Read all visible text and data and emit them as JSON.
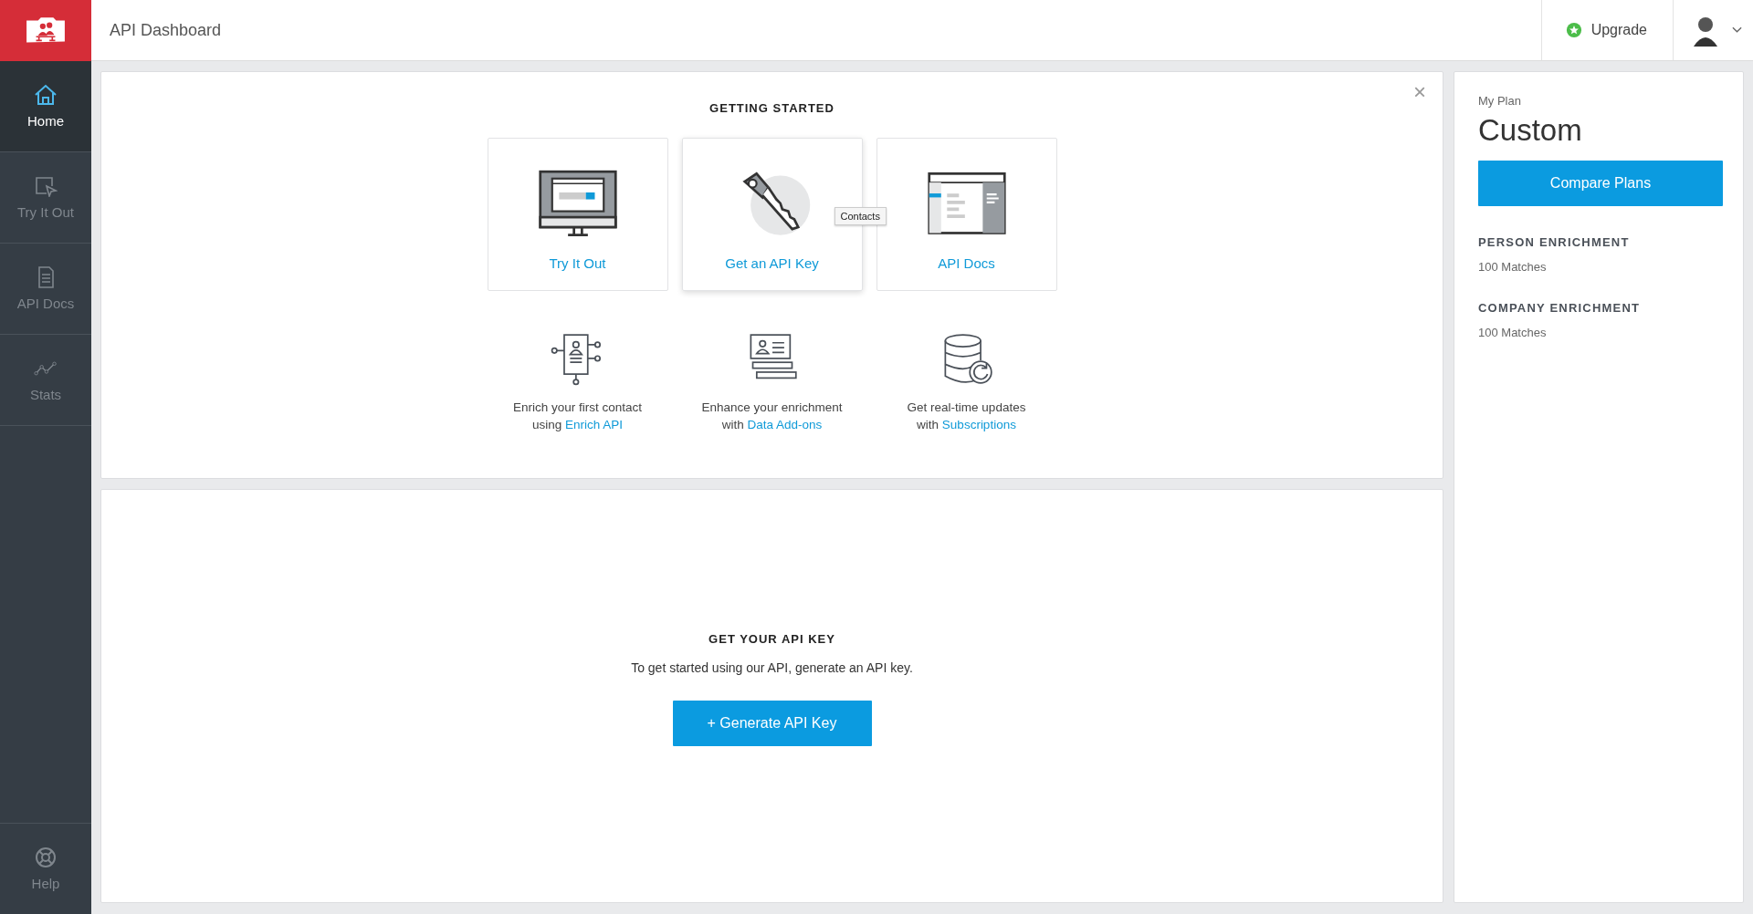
{
  "header": {
    "title": "API Dashboard",
    "upgrade": "Upgrade"
  },
  "sidebar": {
    "items": [
      {
        "label": "Home",
        "selected": true
      },
      {
        "label": "Try It Out",
        "selected": false
      },
      {
        "label": "API Docs",
        "selected": false
      },
      {
        "label": "Stats",
        "selected": false
      }
    ],
    "help": "Help"
  },
  "getting_started": {
    "title": "GETTING STARTED",
    "close": "×",
    "cards": [
      {
        "label": "Try It Out",
        "hovered": false
      },
      {
        "label": "Get an API Key",
        "hovered": true
      },
      {
        "label": "API Docs",
        "hovered": false
      }
    ],
    "tooltip": "Contacts",
    "features": [
      {
        "line1": "Enrich your first contact",
        "prefix": "using",
        "link": "Enrich API"
      },
      {
        "line1": "Enhance your enrichment",
        "prefix": "with",
        "link": "Data Add-ons"
      },
      {
        "line1": "Get real-time updates",
        "prefix": "with",
        "link": "Subscriptions"
      }
    ]
  },
  "api_key": {
    "title": "GET YOUR API KEY",
    "text": "To get started using our API, generate an API key.",
    "button": "+ Generate API Key"
  },
  "plan": {
    "label": "My Plan",
    "name": "Custom",
    "button": "Compare Plans",
    "items": [
      {
        "title": "PERSON ENRICHMENT",
        "value": "100 Matches"
      },
      {
        "title": "COMPANY ENRICHMENT",
        "value": "100 Matches"
      }
    ]
  }
}
